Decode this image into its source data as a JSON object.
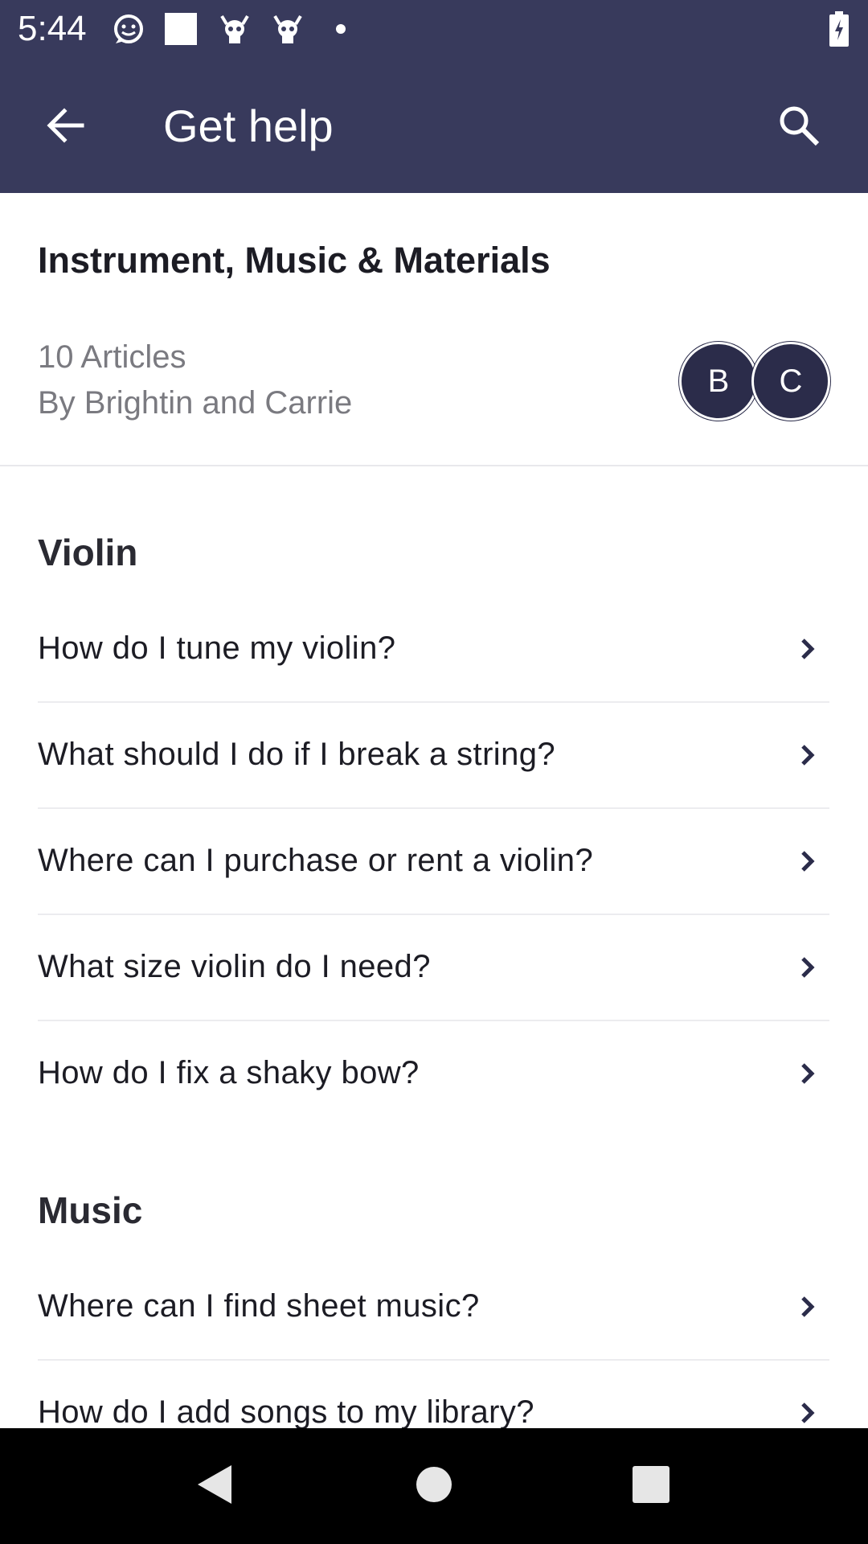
{
  "status_bar": {
    "time": "5:44",
    "icons": [
      "chat-smiley-icon",
      "square-icon",
      "skull-icon",
      "skull-icon",
      "dot-icon",
      "battery-charging-icon"
    ]
  },
  "app_bar": {
    "title": "Get help",
    "back_icon": "arrow-left-icon",
    "search_icon": "search-icon"
  },
  "collection": {
    "title": "Instrument, Music & Materials",
    "article_count": "10 Articles",
    "authors": "By Brightin and Carrie",
    "avatars": [
      "B",
      "C"
    ]
  },
  "sections": [
    {
      "heading": "Violin",
      "articles": [
        "How do I tune my violin?",
        "What should I do if I break a string?",
        "Where can I purchase or rent a violin?",
        "What size violin do I need?",
        "How do I fix a shaky bow?"
      ]
    },
    {
      "heading": "Music",
      "articles": [
        "Where can I find sheet music?",
        "How do I add songs to my library?"
      ]
    }
  ],
  "colors": {
    "app_bar": "#383a5c",
    "avatar": "#2b2c4a",
    "nav_bar": "#000000"
  }
}
